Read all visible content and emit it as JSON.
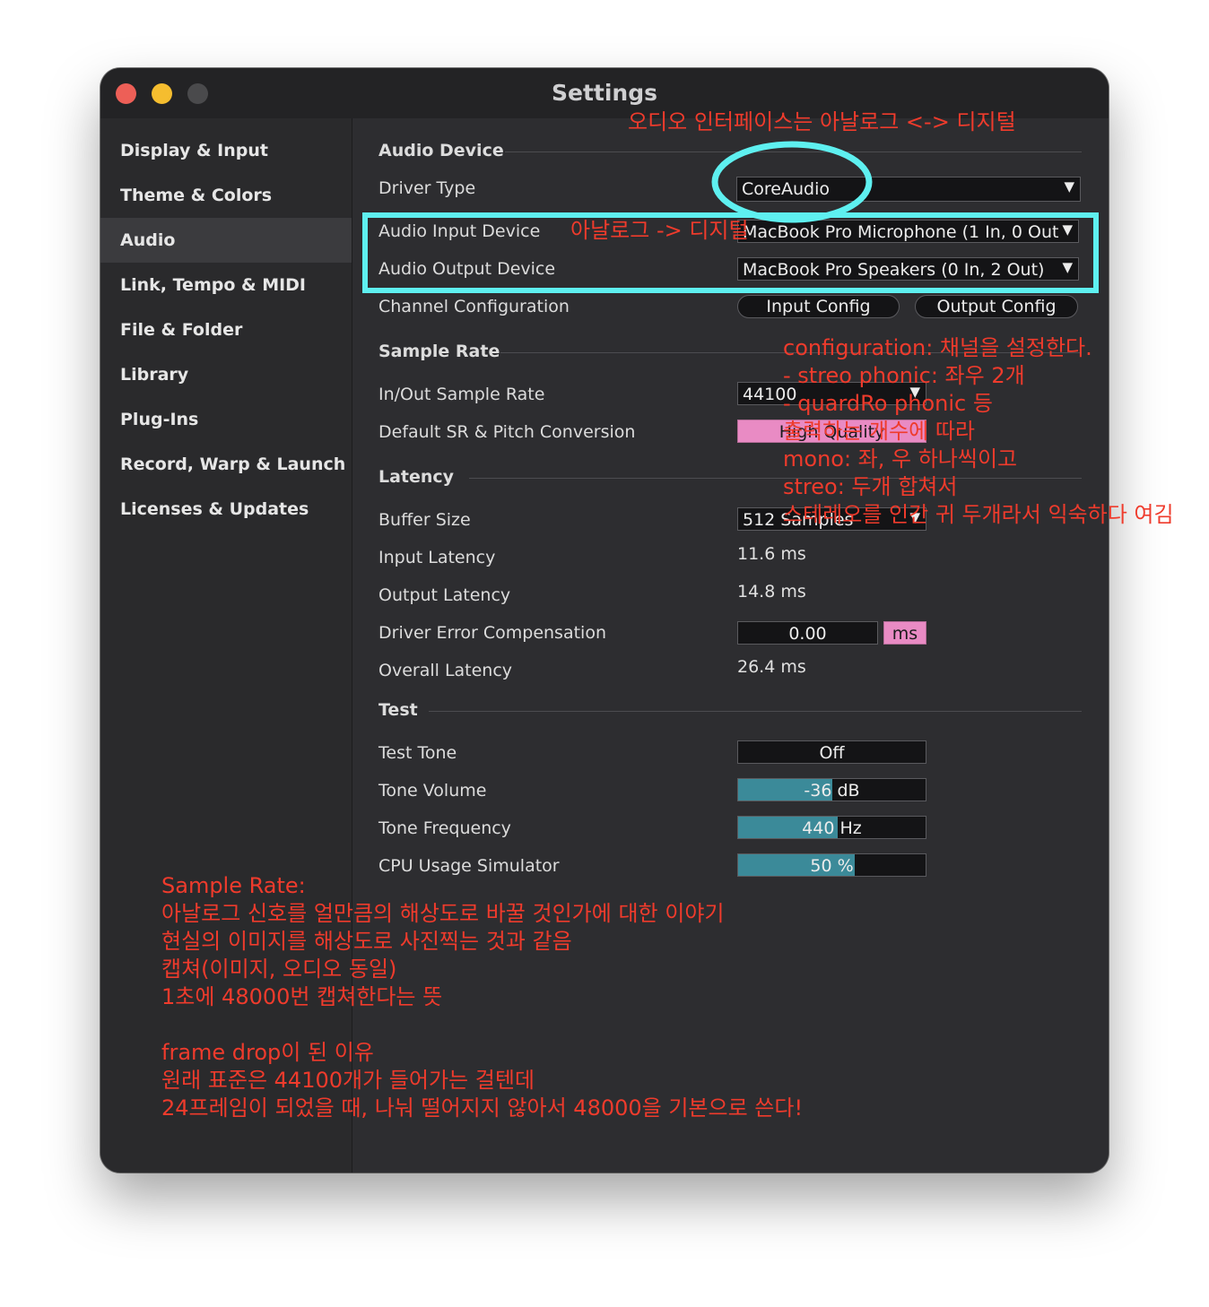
{
  "window": {
    "title": "Settings"
  },
  "sidebar": {
    "items": [
      {
        "label": "Display & Input"
      },
      {
        "label": "Theme & Colors"
      },
      {
        "label": "Audio"
      },
      {
        "label": "Link, Tempo & MIDI"
      },
      {
        "label": "File & Folder"
      },
      {
        "label": "Library"
      },
      {
        "label": "Plug-Ins"
      },
      {
        "label": "Record, Warp & Launch"
      },
      {
        "label": "Licenses & Updates"
      }
    ],
    "active": "Audio"
  },
  "audio_device": {
    "section_title": "Audio Device",
    "driver_type_label": "Driver Type",
    "driver_type_value": "CoreAudio",
    "input_device_label": "Audio Input Device",
    "input_device_value": "MacBook Pro Microphone (1 In, 0 Out",
    "output_device_label": "Audio Output Device",
    "output_device_value": "MacBook Pro Speakers (0 In, 2 Out)",
    "channel_config_label": "Channel Configuration",
    "input_config_button": "Input Config",
    "output_config_button": "Output Config"
  },
  "sample_rate": {
    "section_title": "Sample Rate",
    "inout_label": "In/Out Sample Rate",
    "inout_value": "44100",
    "default_sr_label": "Default SR & Pitch Conversion",
    "default_sr_value": "High Quality"
  },
  "latency": {
    "section_title": "Latency",
    "buffer_label": "Buffer Size",
    "buffer_value": "512 Samples",
    "input_latency_label": "Input Latency",
    "input_latency_value": "11.6 ms",
    "output_latency_label": "Output Latency",
    "output_latency_value": "14.8 ms",
    "driver_error_label": "Driver Error Compensation",
    "driver_error_value": "0.00",
    "driver_error_unit": "ms",
    "overall_label": "Overall Latency",
    "overall_value": "26.4 ms"
  },
  "test": {
    "section_title": "Test",
    "tone_label": "Test Tone",
    "tone_value": "Off",
    "volume_label": "Tone Volume",
    "volume_value": "-36 dB",
    "volume_fill": 0.5,
    "frequency_label": "Tone Frequency",
    "frequency_value": "440 Hz",
    "frequency_fill": 0.53,
    "cpu_label": "CPU Usage Simulator",
    "cpu_value": "50 %",
    "cpu_fill": 0.62
  },
  "annotations": {
    "top": "오디오 인터페이스는 아날로그 <-> 디지털",
    "input": "아날로그 -> 디지털",
    "config_lines": [
      "configuration: 채널을 설정한다.",
      "- streo phonic: 좌우 2개",
      "- quardRo phonic 등",
      "출력하는 개수에 따라",
      "mono: 좌, 우 하나씩이고",
      "streo: 두개 합쳐서",
      "스테레오를 인간 귀 두개라서 익숙하다 여김"
    ],
    "sample_rate_lines": [
      "Sample Rate:",
      "아날로그 신호를 얼만큼의 해상도로 바꿀 것인가에 대한 이야기",
      "현실의 이미지를 해상도로 사진찍는 것과 같음",
      "캡쳐(이미지, 오디오 동일)",
      "1초에 48000번 캡쳐한다는 뜻",
      "",
      "frame drop이 된 이유",
      "원래 표준은 44100개가 들어가는 걸텐데",
      "24프레임이 되었을 때, 나눠 떨어지지 않아서 48000을 기본으로 쓴다!"
    ],
    "color": "#ef3b2c",
    "highlight_color": "#5ef0f0"
  }
}
